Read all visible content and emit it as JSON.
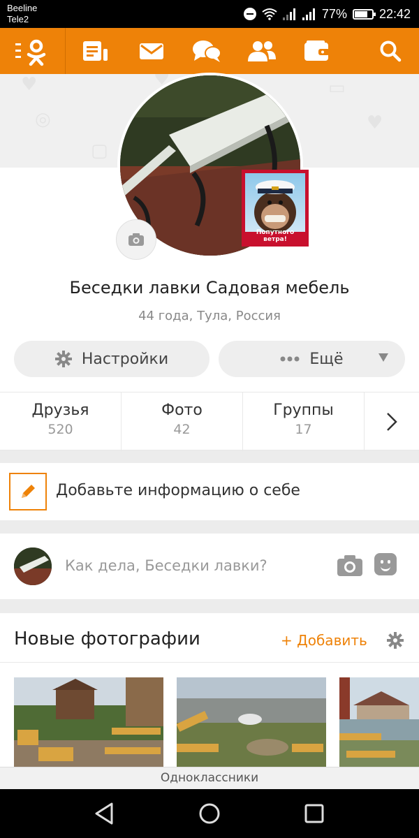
{
  "status_bar": {
    "carrier_1": "Beeline",
    "carrier_2": "Tele2",
    "battery": "77%",
    "battery_level": 0.77,
    "time": "22:42"
  },
  "toolbar": {
    "accent_color": "#ee8208",
    "icons": [
      "menu-logo-icon",
      "notes-icon",
      "messages-icon",
      "discussions-icon",
      "friends-icon",
      "wallet-icon",
      "search-icon"
    ]
  },
  "profile": {
    "name": "Беседки лавки Садовая мебель",
    "info": "44 года, Тула, Россия",
    "sticker_text": "Попутного ветра!"
  },
  "actions": {
    "settings": "Настройки",
    "more": "Ещё"
  },
  "stats": [
    {
      "label": "Друзья",
      "count": "520"
    },
    {
      "label": "Фото",
      "count": "42"
    },
    {
      "label": "Группы",
      "count": "17"
    }
  ],
  "add_info": "Добавьте информацию о себе",
  "post": {
    "placeholder": "Как дела, Беседки лавки?"
  },
  "photos": {
    "title": "Новые фотографии",
    "add": "+ Добавить"
  },
  "footer": "Одноклассники"
}
